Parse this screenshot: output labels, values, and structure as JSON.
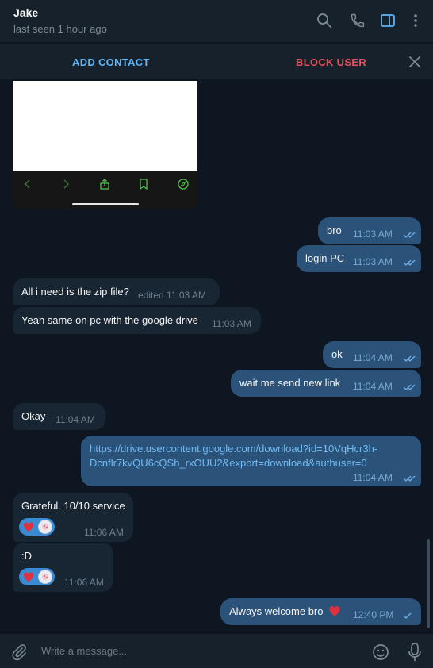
{
  "header": {
    "contact_name": "Jake",
    "last_seen": "last seen 1 hour ago",
    "icons": [
      "search-icon",
      "phone-icon",
      "sidebar-toggle-icon",
      "more-vertical-icon"
    ]
  },
  "action_bar": {
    "add_contact_label": "ADD CONTACT",
    "block_user_label": "BLOCK USER"
  },
  "messages": [
    {
      "dir": "out",
      "text": "bro",
      "time": "11:03 AM",
      "read": true
    },
    {
      "dir": "out",
      "text": "login PC",
      "time": "11:03 AM",
      "read": true
    },
    {
      "dir": "in",
      "text": "All i need is the zip file?",
      "time": "edited 11:03 AM"
    },
    {
      "dir": "in",
      "text": "Yeah same on pc with the google drive",
      "time": "11:03 AM"
    },
    {
      "dir": "out",
      "text": "ok",
      "time": "11:04 AM",
      "read": true
    },
    {
      "dir": "out",
      "text": "wait me send new link",
      "time": "11:04 AM",
      "read": true
    },
    {
      "dir": "in",
      "text": "Okay",
      "time": "11:04 AM"
    },
    {
      "dir": "out",
      "link_line1": "https://drive.usercontent.google.com/download?id=10VqHcr3h-",
      "link_line2": "Dcnflr7kvQU6cQSh_rxOUU2&export=download&authuser=0",
      "time": "11:04 AM",
      "read": true
    },
    {
      "dir": "in",
      "text": "Grateful. 10/10 service",
      "time": "11:06 AM",
      "reaction": "heart"
    },
    {
      "dir": "in",
      "text": ":D",
      "time": "11:06 AM",
      "reaction": "heart"
    },
    {
      "dir": "out",
      "text": "Always welcome bro",
      "emoji": "heart",
      "time": "12:40 PM",
      "read": false
    }
  ],
  "composer": {
    "placeholder": "Write a message..."
  },
  "colors": {
    "background": "#0e1621",
    "panel": "#17212b",
    "outgoing_bubble": "#2b5278",
    "incoming_bubble": "#182533",
    "accent": "#5eb5f7",
    "danger": "#e0515b"
  }
}
